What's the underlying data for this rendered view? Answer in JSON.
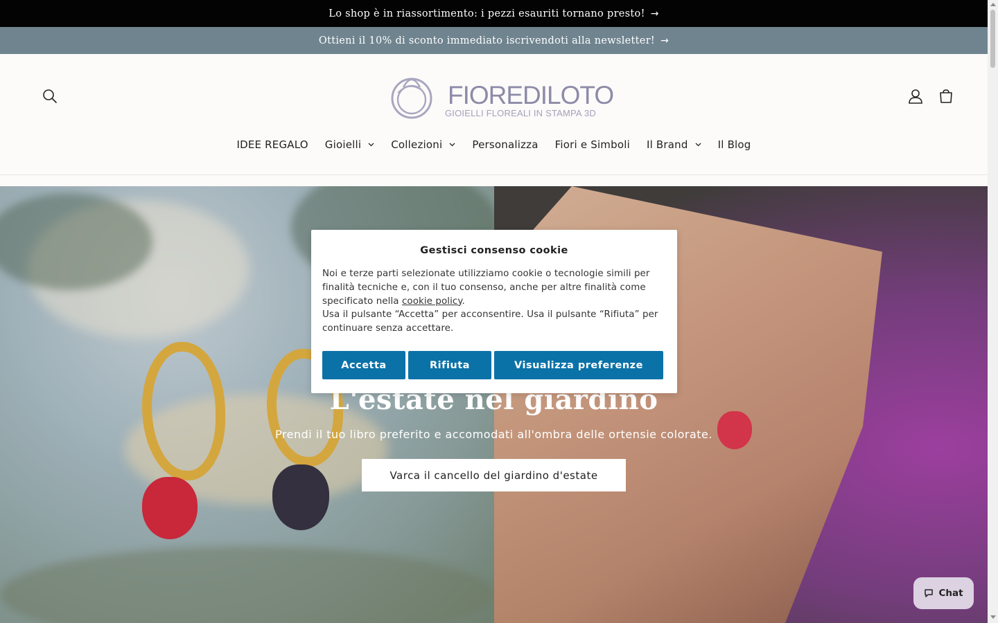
{
  "announcements": {
    "restock_text": "Lo shop è in riassortimento: i pezzi esauriti tornano presto!",
    "newsletter_text": "Ottieni il 10% di sconto immediato iscrivendoti alla newsletter!",
    "arrow": "→"
  },
  "header": {
    "logo_word": "FIOREDILOTO",
    "logo_tagline": "GIOIELLI FLOREALI IN STAMPA 3D",
    "icons": [
      "search-icon",
      "account-icon",
      "cart-icon"
    ]
  },
  "nav": {
    "items": [
      {
        "label": "IDEE REGALO",
        "dropdown": false
      },
      {
        "label": "Gioielli",
        "dropdown": true
      },
      {
        "label": "Collezioni",
        "dropdown": true
      },
      {
        "label": "Personalizza",
        "dropdown": false
      },
      {
        "label": "Fiori e Simboli",
        "dropdown": false
      },
      {
        "label": "Il Brand",
        "dropdown": true
      },
      {
        "label": "Il Blog",
        "dropdown": false
      }
    ]
  },
  "hero": {
    "title": "L'estate nel giardino",
    "subtitle": "Prendi il tuo libro preferito e accomodati all'ombra delle ortensie colorate.",
    "cta": "Varca il cancello del giardino d'estate"
  },
  "cookie_banner": {
    "title": "Gestisci consenso cookie",
    "text_before_link": "Noi e terze parti selezionate utilizziamo cookie o tecnologie simili per finalità tecniche e, con il tuo consenso, anche per altre finalità come specificato nella ",
    "link_text": "cookie policy",
    "text_after_link": ".",
    "text_second": "Usa il pulsante “Accetta” per acconsentire. Usa il pulsante “Rifiuta” per continuare senza accettare.",
    "buttons": {
      "accept": "Accetta",
      "reject": "Rifiuta",
      "preferences": "Visualizza preferenze"
    },
    "button_color": "#0b72a8"
  },
  "chat": {
    "label": "Chat"
  }
}
